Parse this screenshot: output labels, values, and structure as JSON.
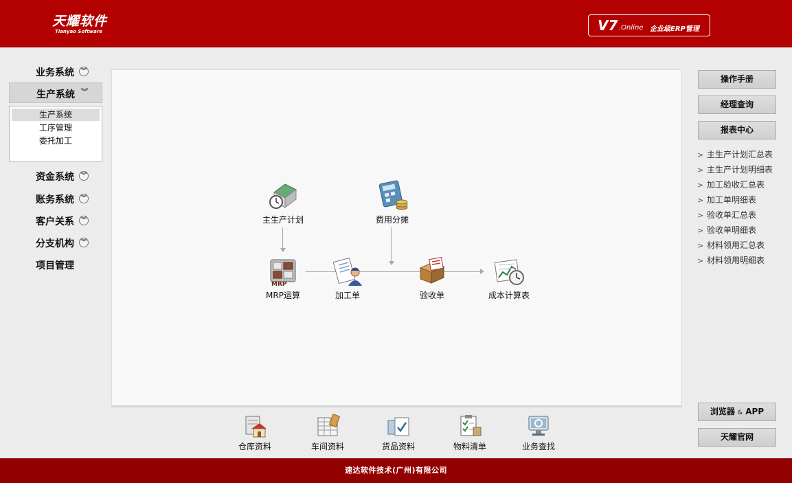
{
  "header": {
    "logo_cn": "天耀软件",
    "logo_en": "Tianyao Software",
    "version": "V7",
    "version_suffix": ".Online",
    "version_desc": "企业级ERP管理"
  },
  "left_menu": {
    "items": [
      {
        "label": "业务系统"
      },
      {
        "label": "生产系统"
      },
      {
        "label": "资金系统"
      },
      {
        "label": "账务系统"
      },
      {
        "label": "客户关系"
      },
      {
        "label": "分支机构"
      },
      {
        "label": "项目管理"
      }
    ],
    "submenu": [
      "生产系统",
      "工序管理",
      "委托加工"
    ]
  },
  "flow": {
    "nodes": [
      {
        "label": "主生产计划",
        "icon": "plan-icon"
      },
      {
        "label": "费用分摊",
        "icon": "calculator-coins-icon"
      },
      {
        "label": "MRP运算",
        "icon": "mrp-calculator-icon"
      },
      {
        "label": "加工单",
        "icon": "worker-clipboard-icon"
      },
      {
        "label": "验收单",
        "icon": "receipt-book-icon"
      },
      {
        "label": "成本计算表",
        "icon": "cost-chart-icon"
      }
    ]
  },
  "toolbar": {
    "items": [
      {
        "label": "仓库资料",
        "icon": "warehouse-icon"
      },
      {
        "label": "车间资料",
        "icon": "workshop-icon"
      },
      {
        "label": "货品资料",
        "icon": "goods-icon"
      },
      {
        "label": "物料清单",
        "icon": "checklist-icon"
      },
      {
        "label": "业务查找",
        "icon": "search-monitor-icon"
      }
    ]
  },
  "right_panel": {
    "buttons": [
      "操作手册",
      "经理查询",
      "报表中心"
    ],
    "reports": [
      "主生产计划汇总表",
      "主生产计划明细表",
      "加工验收汇总表",
      "加工单明细表",
      "验收单汇总表",
      "验收单明细表",
      "材料领用汇总表",
      "材料领用明细表"
    ],
    "bottom_buttons": {
      "browser": "浏览器",
      "amp": "&",
      "app": "APP",
      "site": "天耀官网"
    }
  },
  "footer": {
    "text": "速达软件技术(广州)有限公司"
  },
  "colors": {
    "header": "#b30000",
    "footer": "#930000"
  }
}
